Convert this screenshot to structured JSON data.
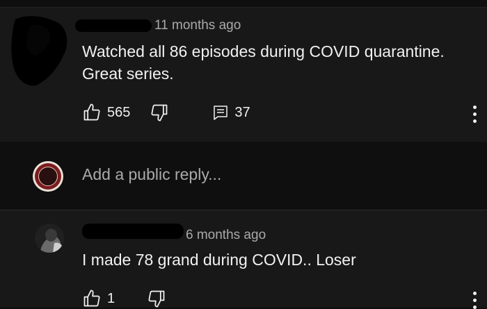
{
  "comment1": {
    "time": "11 months ago",
    "line1": "Watched all 86 episodes during COVID quarantine.",
    "line2": "Great series.",
    "likes": "565",
    "replies": "37"
  },
  "reply": {
    "placeholder": "Add a public reply..."
  },
  "comment2": {
    "time": "6 months ago",
    "text": "I made 78 grand during COVID.. Loser",
    "likes": "1"
  },
  "icons": {
    "like": "thumbs-up-icon",
    "dislike": "thumbs-down-icon",
    "replies": "comment-icon",
    "more": "more-vert-icon"
  },
  "colors": {
    "background": "#0f0f0f",
    "card": "#181818",
    "text": "#f1f1f1",
    "muted": "#aaaaaa"
  }
}
